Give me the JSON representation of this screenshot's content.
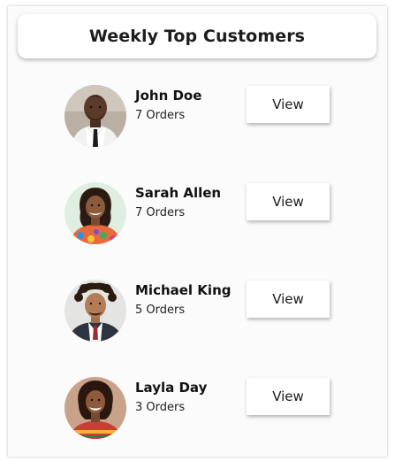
{
  "header": {
    "title": "Weekly Top Customers"
  },
  "customers": [
    {
      "name": "John Doe",
      "orders": "7 Orders",
      "button": "View",
      "avatar_icon": "john-doe-avatar"
    },
    {
      "name": "Sarah Allen",
      "orders": "7 Orders",
      "button": "View",
      "avatar_icon": "sarah-allen-avatar"
    },
    {
      "name": "Michael King",
      "orders": "5 Orders",
      "button": "View",
      "avatar_icon": "michael-king-avatar"
    },
    {
      "name": "Layla Day",
      "orders": "3 Orders",
      "button": "View",
      "avatar_icon": "layla-day-avatar"
    }
  ],
  "colors": {
    "card_background": "#fbfbfb",
    "button_background": "#ffffff",
    "text": "#111111"
  }
}
